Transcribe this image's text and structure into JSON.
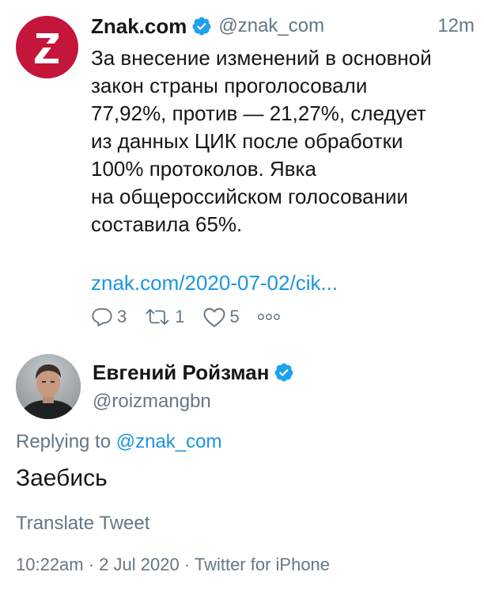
{
  "parent_tweet": {
    "author_name": "Znak.com",
    "handle": "@znak_com",
    "time": "12m",
    "text_lines": [
      "За внесение изменений в основной",
      "закон страны проголосовали",
      "77,92%, против — 21,27%, следует",
      "из данных ЦИК после обработки",
      "100% протоколов. Явка",
      "на общероссийском голосовании",
      "составила 65%."
    ],
    "link": "znak.com/2020-07-02/cik...",
    "reply_count": "3",
    "retweet_count": "1",
    "like_count": "5",
    "avatar_letter": "Z",
    "brand_color": "#c3163a"
  },
  "reply_tweet": {
    "author_name": "Евгений Ройзман",
    "handle": "@roizmangbn",
    "replying_prefix": "Replying to",
    "replying_mention": "@znak_com",
    "text": "Заебись",
    "translate_label": "Translate Tweet",
    "meta": "10:22am · 2 Jul 2020 · Twitter for iPhone"
  },
  "colors": {
    "link": "#1b95e0",
    "secondary": "#657786",
    "verified": "#1da1f2"
  },
  "icons": {
    "verified": "verified-badge-icon",
    "reply": "reply-icon",
    "retweet": "retweet-icon",
    "like": "heart-icon",
    "more": "more-dots-icon"
  }
}
